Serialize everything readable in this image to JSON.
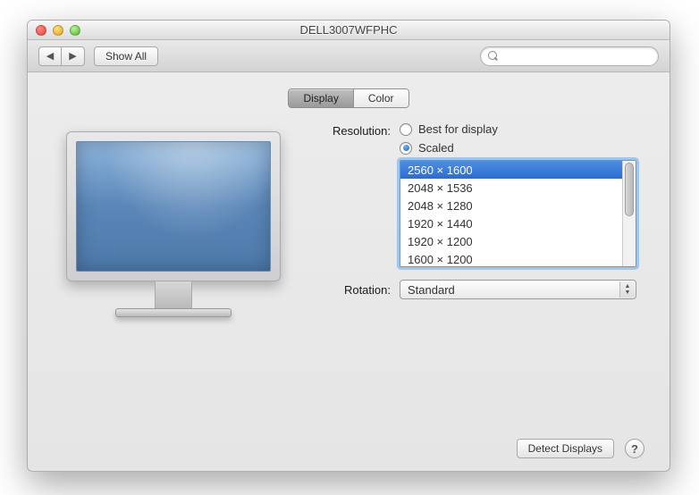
{
  "window": {
    "title": "DELL3007WFPHC"
  },
  "toolbar": {
    "show_all": "Show All",
    "search_placeholder": ""
  },
  "tabs": {
    "display": "Display",
    "color": "Color",
    "active": "display"
  },
  "resolution": {
    "label": "Resolution:",
    "best_label": "Best for display",
    "scaled_label": "Scaled",
    "selection": "scaled",
    "options": [
      "2560 × 1600",
      "2048 × 1536",
      "2048 × 1280",
      "1920 × 1440",
      "1920 × 1200",
      "1600 × 1200"
    ],
    "selected_index": 0
  },
  "rotation": {
    "label": "Rotation:",
    "value": "Standard"
  },
  "footer": {
    "detect": "Detect Displays",
    "help": "?"
  }
}
